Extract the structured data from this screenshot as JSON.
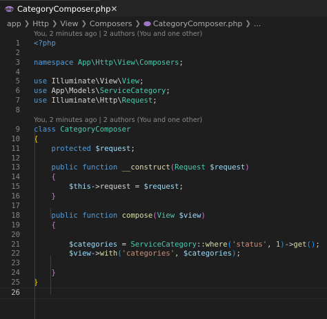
{
  "tab": {
    "filename": "CategoryComposer.php",
    "close": "✕"
  },
  "breadcrumb": {
    "segments": [
      "app",
      "Http",
      "View",
      "Composers",
      "CategoryComposer.php",
      "..."
    ]
  },
  "codelens": {
    "text": "You, 2 minutes ago | 2 authors (You and one other)"
  },
  "code": {
    "l1": "<?php",
    "l3_kw": "namespace",
    "l3_ns": "App\\Http\\View\\Composers",
    "l3_end": ";",
    "l5_kw": "use",
    "l5_a": "Illuminate\\View\\",
    "l5_b": "View",
    "l5_end": ";",
    "l6_kw": "use",
    "l6_a": "App\\Models\\",
    "l6_b": "ServiceCategory",
    "l6_end": ";",
    "l7_kw": "use",
    "l7_a": "Illuminate\\Http\\",
    "l7_b": "Request",
    "l7_end": ";",
    "l9_kw": "class",
    "l9_cls": "CategoryComposer",
    "open": "{",
    "close": "}",
    "l11_kw": "protected",
    "l11_var": "$request",
    "semi": ";",
    "l13_kw1": "public",
    "l13_kw2": "function",
    "l13_fn": "__construct",
    "l13_type": "Request",
    "l13_var": "$request",
    "l15_this": "$this",
    "l15_arrow": "->",
    "l15_prop": "request",
    "l15_eq": " = ",
    "l15_var": "$request",
    "l18_kw1": "public",
    "l18_kw2": "function",
    "l18_fn": "compose",
    "l18_type": "View",
    "l18_var": "$view",
    "l21_var": "$categories",
    "l21_eq": " = ",
    "l21_cls": "ServiceCategory",
    "l21_dc": "::",
    "l21_fn1": "where",
    "l21_str": "'status'",
    "l21_comma": ", ",
    "l21_num": "1",
    "l21_arrow": "->",
    "l21_fn2": "get",
    "l22_var": "$view",
    "l22_arrow": "->",
    "l22_fn": "with",
    "l22_str": "'categories'",
    "l22_comma": ", ",
    "l22_var2": "$categories"
  },
  "line_numbers": [
    "1",
    "2",
    "3",
    "4",
    "5",
    "6",
    "7",
    "8",
    "9",
    "10",
    "11",
    "12",
    "13",
    "14",
    "15",
    "16",
    "17",
    "18",
    "19",
    "20",
    "21",
    "22",
    "23",
    "24",
    "25",
    "26"
  ]
}
